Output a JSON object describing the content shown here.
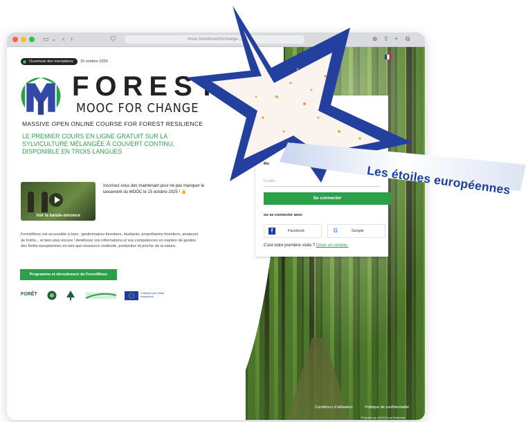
{
  "browser": {
    "url": "mooc.forestmoocforchange..."
  },
  "badge": {
    "label": "Ouverture des inscriptions",
    "date": "15 octobre 2025"
  },
  "brand": {
    "title": "FOREST",
    "subtitle": "MOOC FOR CHANGE",
    "tagline": "MASSIVE OPEN ONLINE COURSE  FOR FOREST RESILIENCE",
    "headline": "LE PREMIER COURS EN LIGNE GRATUIT SUR LA SYLVICULTURE MÉLANGÉE À COUVERT CONTINU, DISPONIBLE EN TROIS LANGUES"
  },
  "video": {
    "caption": "Voir la bande-annonce"
  },
  "invite": "Inscrivez-vous dès maintenant pour ne pas manquer le lancement du MOOC le 15 octobre 2025 ! 👍",
  "description": "ForestMooc est accessible à tous : gestionnaires forestiers, étudiants, propriétaires forestiers, amateurs de forêts... et bien plus encore ! Améliorez vos informations et vos compétences en matière de gestion des forêts européennes en tant que ressource résiliente, productive et proche de la nature.",
  "program_button": "Programme et déroulement du ForestMooc",
  "partners": {
    "foret": "FORÊT",
    "eu_text": "Cofinancé par l'Union européenne"
  },
  "login": {
    "field_label": "Mo",
    "field_placeholder": "Le mot...",
    "submit": "Se connecter",
    "or_connect": "ou se connecter avec",
    "facebook": "Facebook",
    "google": "Google",
    "first_visit": "C'est votre première visite ?",
    "create_account": "Créer un compte."
  },
  "footer": {
    "terms": "Conditions d'utilisation",
    "privacy": "Politique de confidentialité",
    "powered": "Propulsé par MOOCit par Braincube"
  },
  "overlay": {
    "banner": "Les étoiles européennes"
  },
  "colors": {
    "green": "#2aa149",
    "star_blue": "#1d3d9c",
    "dark": "#222222"
  }
}
